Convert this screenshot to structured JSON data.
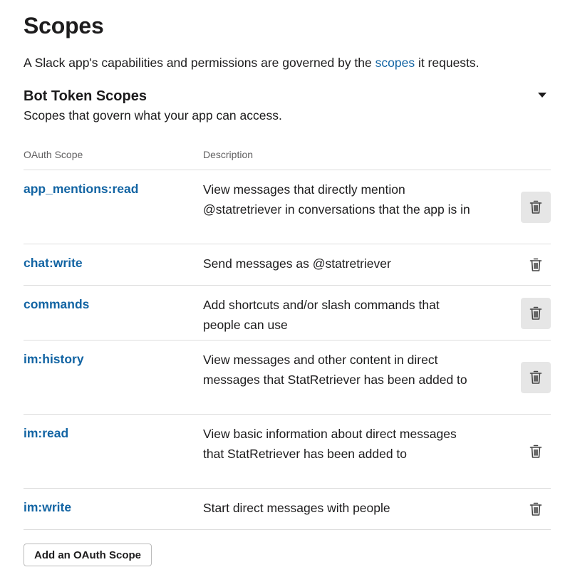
{
  "page": {
    "title": "Scopes",
    "intro_before": "A Slack app's capabilities and permissions are governed by the ",
    "intro_link": "scopes",
    "intro_after": " it requests."
  },
  "section": {
    "title": "Bot Token Scopes",
    "subtitle": "Scopes that govern what your app can access."
  },
  "table": {
    "headers": [
      "OAuth Scope",
      "Description"
    ],
    "rows": [
      {
        "scope": "app_mentions:read",
        "description": "View messages that directly mention @statretriever in conversations that the app is in",
        "delete_highlighted": true
      },
      {
        "scope": "chat:write",
        "description": "Send messages as @statretriever",
        "delete_highlighted": false
      },
      {
        "scope": "commands",
        "description": "Add shortcuts and/or slash commands that people can use",
        "delete_highlighted": true
      },
      {
        "scope": "im:history",
        "description": "View messages and other content in direct messages that StatRetriever has been added to",
        "delete_highlighted": true
      },
      {
        "scope": "im:read",
        "description": "View basic information about direct messages that StatRetriever has been added to",
        "delete_highlighted": false
      },
      {
        "scope": "im:write",
        "description": "Start direct messages with people",
        "delete_highlighted": false
      }
    ]
  },
  "add_button": "Add an OAuth Scope",
  "icons": {
    "delete": "trash-icon",
    "collapse": "caret-down-icon"
  },
  "colors": {
    "link": "#1264a3",
    "text": "#1d1c1d",
    "muted": "#616061",
    "divider": "#dddddd"
  }
}
